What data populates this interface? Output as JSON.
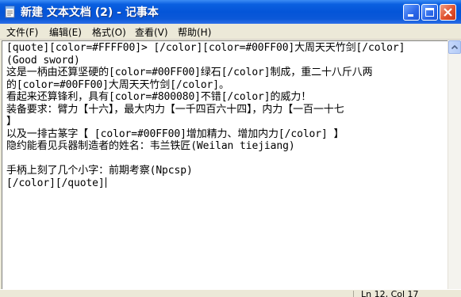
{
  "window": {
    "title": "新建 文本文档 (2) - 记事本",
    "app_icon": "notepad-icon",
    "controls": {
      "minimize_icon": "minimize-icon",
      "maximize_icon": "maximize-icon",
      "close_icon": "close-icon"
    }
  },
  "menu": {
    "items": [
      {
        "label": "文件(F)"
      },
      {
        "label": "编辑(E)"
      },
      {
        "label": "格式(O)"
      },
      {
        "label": "查看(V)"
      },
      {
        "label": "帮助(H)"
      }
    ]
  },
  "editor": {
    "lines": [
      "[quote][color=#FFFF00]> [/color][color=#00FF00]大周天天竹剑[/color]",
      "(Good sword)",
      "这是一柄由还算坚硬的[color=#00FF00]绿石[/color]制成，重二十八斤八两",
      "的[color=#00FF00]大周天天竹剑[/color]。",
      "看起来还算锋利，具有[color=#800080]不错[/color]的威力！",
      "装备要求：臂力【十六】，最大内力【一千四百六十四】，内力【一百一十七",
      "】",
      "以及一排古篆字【 [color=#00FF00]增加精力、增加内力[/color] 】",
      "隐约能看见兵器制造者的姓名：韦兰铁匠(Weilan tiejiang)",
      "",
      "手柄上刻了几个小字：前期考察(Npcsp)",
      "[/color][/quote]"
    ]
  },
  "status": {
    "position": "Ln 12, Col 17"
  }
}
